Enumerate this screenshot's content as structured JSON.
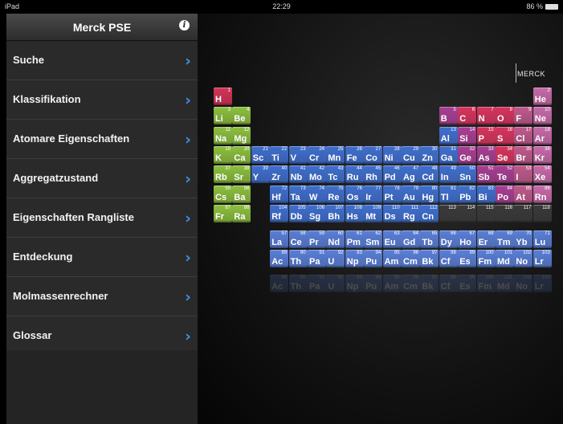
{
  "status_bar": {
    "device": "iPad",
    "time": "22:29",
    "battery": "86 %"
  },
  "sidebar": {
    "title": "Merck PSE",
    "menu": [
      {
        "label": "Suche"
      },
      {
        "label": "Klassifikation"
      },
      {
        "label": "Atomare Eigenschaften"
      },
      {
        "label": "Aggregatzustand"
      },
      {
        "label": "Eigenschaften Rangliste"
      },
      {
        "label": "Entdeckung"
      },
      {
        "label": "Molmassenrechner"
      },
      {
        "label": "Glossar"
      }
    ]
  },
  "logo": {
    "text": "MERCK"
  },
  "colors": {
    "alkali_earth": "#8dc03f",
    "transition": "#3f6fcf",
    "metal": "#3f6fcf",
    "metalloid": "#a93e94",
    "nonmetal": "#d8345e",
    "halogen": "#c05a8c",
    "noble": "#c86aaa",
    "hydrogen": "#d43456",
    "unknown": "#3a3a3a",
    "lanthanide": "#5a7fd8",
    "actinide": "#5a7fd8",
    "chevron": "#3d8fe0"
  },
  "elements": [
    {
      "z": 1,
      "s": "H",
      "c": "hydrogen",
      "r": 1,
      "g": 1
    },
    {
      "z": 2,
      "s": "He",
      "c": "noble",
      "r": 1,
      "g": 18
    },
    {
      "z": 3,
      "s": "Li",
      "c": "alkali_earth",
      "r": 2,
      "g": 1
    },
    {
      "z": 4,
      "s": "Be",
      "c": "alkali_earth",
      "r": 2,
      "g": 2
    },
    {
      "z": 5,
      "s": "B",
      "c": "metalloid",
      "r": 2,
      "g": 13
    },
    {
      "z": 6,
      "s": "C",
      "c": "nonmetal",
      "r": 2,
      "g": 14
    },
    {
      "z": 7,
      "s": "N",
      "c": "nonmetal",
      "r": 2,
      "g": 15
    },
    {
      "z": 8,
      "s": "O",
      "c": "nonmetal",
      "r": 2,
      "g": 16
    },
    {
      "z": 9,
      "s": "F",
      "c": "halogen",
      "r": 2,
      "g": 17
    },
    {
      "z": 10,
      "s": "Ne",
      "c": "noble",
      "r": 2,
      "g": 18
    },
    {
      "z": 11,
      "s": "Na",
      "c": "alkali_earth",
      "r": 3,
      "g": 1
    },
    {
      "z": 12,
      "s": "Mg",
      "c": "alkali_earth",
      "r": 3,
      "g": 2
    },
    {
      "z": 13,
      "s": "Al",
      "c": "metal",
      "r": 3,
      "g": 13
    },
    {
      "z": 14,
      "s": "Si",
      "c": "metalloid",
      "r": 3,
      "g": 14
    },
    {
      "z": 15,
      "s": "P",
      "c": "nonmetal",
      "r": 3,
      "g": 15
    },
    {
      "z": 16,
      "s": "S",
      "c": "nonmetal",
      "r": 3,
      "g": 16
    },
    {
      "z": 17,
      "s": "Cl",
      "c": "halogen",
      "r": 3,
      "g": 17
    },
    {
      "z": 18,
      "s": "Ar",
      "c": "noble",
      "r": 3,
      "g": 18
    },
    {
      "z": 19,
      "s": "K",
      "c": "alkali_earth",
      "r": 4,
      "g": 1
    },
    {
      "z": 20,
      "s": "Ca",
      "c": "alkali_earth",
      "r": 4,
      "g": 2
    },
    {
      "z": 21,
      "s": "Sc",
      "c": "transition",
      "r": 4,
      "g": 3
    },
    {
      "z": 22,
      "s": "Ti",
      "c": "transition",
      "r": 4,
      "g": 4
    },
    {
      "z": 23,
      "s": "V",
      "c": "transition",
      "r": 4,
      "g": 5
    },
    {
      "z": 24,
      "s": "Cr",
      "c": "transition",
      "r": 4,
      "g": 6
    },
    {
      "z": 25,
      "s": "Mn",
      "c": "transition",
      "r": 4,
      "g": 7
    },
    {
      "z": 26,
      "s": "Fe",
      "c": "transition",
      "r": 4,
      "g": 8
    },
    {
      "z": 27,
      "s": "Co",
      "c": "transition",
      "r": 4,
      "g": 9
    },
    {
      "z": 28,
      "s": "Ni",
      "c": "transition",
      "r": 4,
      "g": 10
    },
    {
      "z": 29,
      "s": "Cu",
      "c": "transition",
      "r": 4,
      "g": 11
    },
    {
      "z": 30,
      "s": "Zn",
      "c": "transition",
      "r": 4,
      "g": 12
    },
    {
      "z": 31,
      "s": "Ga",
      "c": "metal",
      "r": 4,
      "g": 13
    },
    {
      "z": 32,
      "s": "Ge",
      "c": "metalloid",
      "r": 4,
      "g": 14
    },
    {
      "z": 33,
      "s": "As",
      "c": "metalloid",
      "r": 4,
      "g": 15
    },
    {
      "z": 34,
      "s": "Se",
      "c": "nonmetal",
      "r": 4,
      "g": 16
    },
    {
      "z": 35,
      "s": "Br",
      "c": "halogen",
      "r": 4,
      "g": 17
    },
    {
      "z": 36,
      "s": "Kr",
      "c": "noble",
      "r": 4,
      "g": 18
    },
    {
      "z": 37,
      "s": "Rb",
      "c": "alkali_earth",
      "r": 5,
      "g": 1
    },
    {
      "z": 38,
      "s": "Sr",
      "c": "alkali_earth",
      "r": 5,
      "g": 2
    },
    {
      "z": 39,
      "s": "Y",
      "c": "transition",
      "r": 5,
      "g": 3
    },
    {
      "z": 40,
      "s": "Zr",
      "c": "transition",
      "r": 5,
      "g": 4
    },
    {
      "z": 41,
      "s": "Nb",
      "c": "transition",
      "r": 5,
      "g": 5
    },
    {
      "z": 42,
      "s": "Mo",
      "c": "transition",
      "r": 5,
      "g": 6
    },
    {
      "z": 43,
      "s": "Tc",
      "c": "transition",
      "r": 5,
      "g": 7
    },
    {
      "z": 44,
      "s": "Ru",
      "c": "transition",
      "r": 5,
      "g": 8
    },
    {
      "z": 45,
      "s": "Rh",
      "c": "transition",
      "r": 5,
      "g": 9
    },
    {
      "z": 46,
      "s": "Pd",
      "c": "transition",
      "r": 5,
      "g": 10
    },
    {
      "z": 47,
      "s": "Ag",
      "c": "transition",
      "r": 5,
      "g": 11
    },
    {
      "z": 48,
      "s": "Cd",
      "c": "transition",
      "r": 5,
      "g": 12
    },
    {
      "z": 49,
      "s": "In",
      "c": "metal",
      "r": 5,
      "g": 13
    },
    {
      "z": 50,
      "s": "Sn",
      "c": "metal",
      "r": 5,
      "g": 14
    },
    {
      "z": 51,
      "s": "Sb",
      "c": "metalloid",
      "r": 5,
      "g": 15
    },
    {
      "z": 52,
      "s": "Te",
      "c": "metalloid",
      "r": 5,
      "g": 16
    },
    {
      "z": 53,
      "s": "I",
      "c": "halogen",
      "r": 5,
      "g": 17
    },
    {
      "z": 54,
      "s": "Xe",
      "c": "noble",
      "r": 5,
      "g": 18
    },
    {
      "z": 55,
      "s": "Cs",
      "c": "alkali_earth",
      "r": 6,
      "g": 1
    },
    {
      "z": 56,
      "s": "Ba",
      "c": "alkali_earth",
      "r": 6,
      "g": 2
    },
    {
      "z": 72,
      "s": "Hf",
      "c": "transition",
      "r": 6,
      "g": 4
    },
    {
      "z": 73,
      "s": "Ta",
      "c": "transition",
      "r": 6,
      "g": 5
    },
    {
      "z": 74,
      "s": "W",
      "c": "transition",
      "r": 6,
      "g": 6
    },
    {
      "z": 75,
      "s": "Re",
      "c": "transition",
      "r": 6,
      "g": 7
    },
    {
      "z": 76,
      "s": "Os",
      "c": "transition",
      "r": 6,
      "g": 8
    },
    {
      "z": 77,
      "s": "Ir",
      "c": "transition",
      "r": 6,
      "g": 9
    },
    {
      "z": 78,
      "s": "Pt",
      "c": "transition",
      "r": 6,
      "g": 10
    },
    {
      "z": 79,
      "s": "Au",
      "c": "transition",
      "r": 6,
      "g": 11
    },
    {
      "z": 80,
      "s": "Hg",
      "c": "transition",
      "r": 6,
      "g": 12
    },
    {
      "z": 81,
      "s": "Tl",
      "c": "metal",
      "r": 6,
      "g": 13
    },
    {
      "z": 82,
      "s": "Pb",
      "c": "metal",
      "r": 6,
      "g": 14
    },
    {
      "z": 83,
      "s": "Bi",
      "c": "metal",
      "r": 6,
      "g": 15
    },
    {
      "z": 84,
      "s": "Po",
      "c": "metalloid",
      "r": 6,
      "g": 16
    },
    {
      "z": 85,
      "s": "At",
      "c": "halogen",
      "r": 6,
      "g": 17
    },
    {
      "z": 86,
      "s": "Rn",
      "c": "noble",
      "r": 6,
      "g": 18
    },
    {
      "z": 87,
      "s": "Fr",
      "c": "alkali_earth",
      "r": 7,
      "g": 1
    },
    {
      "z": 88,
      "s": "Ra",
      "c": "alkali_earth",
      "r": 7,
      "g": 2
    },
    {
      "z": 104,
      "s": "Rf",
      "c": "transition",
      "r": 7,
      "g": 4
    },
    {
      "z": 105,
      "s": "Db",
      "c": "transition",
      "r": 7,
      "g": 5
    },
    {
      "z": 106,
      "s": "Sg",
      "c": "transition",
      "r": 7,
      "g": 6
    },
    {
      "z": 107,
      "s": "Bh",
      "c": "transition",
      "r": 7,
      "g": 7
    },
    {
      "z": 108,
      "s": "Hs",
      "c": "transition",
      "r": 7,
      "g": 8
    },
    {
      "z": 109,
      "s": "Mt",
      "c": "transition",
      "r": 7,
      "g": 9
    },
    {
      "z": 110,
      "s": "Ds",
      "c": "transition",
      "r": 7,
      "g": 10
    },
    {
      "z": 111,
      "s": "Rg",
      "c": "transition",
      "r": 7,
      "g": 11
    },
    {
      "z": 112,
      "s": "Cn",
      "c": "transition",
      "r": 7,
      "g": 12
    },
    {
      "z": 113,
      "s": "",
      "c": "unknown",
      "r": 7,
      "g": 13
    },
    {
      "z": 114,
      "s": "",
      "c": "unknown",
      "r": 7,
      "g": 14
    },
    {
      "z": 115,
      "s": "",
      "c": "unknown",
      "r": 7,
      "g": 15
    },
    {
      "z": 116,
      "s": "",
      "c": "unknown",
      "r": 7,
      "g": 16
    },
    {
      "z": 117,
      "s": "",
      "c": "unknown",
      "r": 7,
      "g": 17
    },
    {
      "z": 118,
      "s": "",
      "c": "unknown",
      "r": 7,
      "g": 18
    },
    {
      "z": 57,
      "s": "La",
      "c": "lanthanide",
      "r": 9,
      "g": 4
    },
    {
      "z": 58,
      "s": "Ce",
      "c": "lanthanide",
      "r": 9,
      "g": 5
    },
    {
      "z": 59,
      "s": "Pr",
      "c": "lanthanide",
      "r": 9,
      "g": 6
    },
    {
      "z": 60,
      "s": "Nd",
      "c": "lanthanide",
      "r": 9,
      "g": 7
    },
    {
      "z": 61,
      "s": "Pm",
      "c": "lanthanide",
      "r": 9,
      "g": 8
    },
    {
      "z": 62,
      "s": "Sm",
      "c": "lanthanide",
      "r": 9,
      "g": 9
    },
    {
      "z": 63,
      "s": "Eu",
      "c": "lanthanide",
      "r": 9,
      "g": 10
    },
    {
      "z": 64,
      "s": "Gd",
      "c": "lanthanide",
      "r": 9,
      "g": 11
    },
    {
      "z": 65,
      "s": "Tb",
      "c": "lanthanide",
      "r": 9,
      "g": 12
    },
    {
      "z": 66,
      "s": "Dy",
      "c": "lanthanide",
      "r": 9,
      "g": 13
    },
    {
      "z": 67,
      "s": "Ho",
      "c": "lanthanide",
      "r": 9,
      "g": 14
    },
    {
      "z": 68,
      "s": "Er",
      "c": "lanthanide",
      "r": 9,
      "g": 15
    },
    {
      "z": 69,
      "s": "Tm",
      "c": "lanthanide",
      "r": 9,
      "g": 16
    },
    {
      "z": 70,
      "s": "Yb",
      "c": "lanthanide",
      "r": 9,
      "g": 17
    },
    {
      "z": 71,
      "s": "Lu",
      "c": "lanthanide",
      "r": 9,
      "g": 18
    },
    {
      "z": 89,
      "s": "Ac",
      "c": "actinide",
      "r": 10,
      "g": 4
    },
    {
      "z": 90,
      "s": "Th",
      "c": "actinide",
      "r": 10,
      "g": 5
    },
    {
      "z": 91,
      "s": "Pa",
      "c": "actinide",
      "r": 10,
      "g": 6
    },
    {
      "z": 92,
      "s": "U",
      "c": "actinide",
      "r": 10,
      "g": 7
    },
    {
      "z": 93,
      "s": "Np",
      "c": "actinide",
      "r": 10,
      "g": 8
    },
    {
      "z": 94,
      "s": "Pu",
      "c": "actinide",
      "r": 10,
      "g": 9
    },
    {
      "z": 95,
      "s": "Am",
      "c": "actinide",
      "r": 10,
      "g": 10
    },
    {
      "z": 96,
      "s": "Cm",
      "c": "actinide",
      "r": 10,
      "g": 11
    },
    {
      "z": 97,
      "s": "Bk",
      "c": "actinide",
      "r": 10,
      "g": 12
    },
    {
      "z": 98,
      "s": "Cf",
      "c": "actinide",
      "r": 10,
      "g": 13
    },
    {
      "z": 99,
      "s": "Es",
      "c": "actinide",
      "r": 10,
      "g": 14
    },
    {
      "z": 100,
      "s": "Fm",
      "c": "actinide",
      "r": 10,
      "g": 15
    },
    {
      "z": 101,
      "s": "Md",
      "c": "actinide",
      "r": 10,
      "g": 16
    },
    {
      "z": 102,
      "s": "No",
      "c": "actinide",
      "r": 10,
      "g": 17
    },
    {
      "z": 103,
      "s": "Lr",
      "c": "actinide",
      "r": 10,
      "g": 18
    }
  ]
}
